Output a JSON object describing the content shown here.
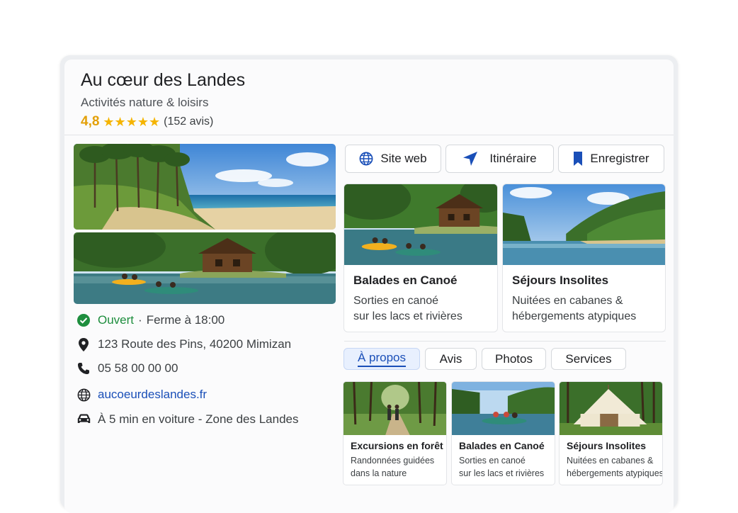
{
  "business": {
    "name": "Au cœur des Landes",
    "category": "Activités nature & loisirs",
    "rating": "4,8",
    "rating_value": 4.8,
    "stars": "★★★★★",
    "reviews": "(152 avis)"
  },
  "info": {
    "status": "Ouvert",
    "separator": "·",
    "hours": "Ferme à 18:00",
    "address": "123 Route des Pins,  40200 Mimizan",
    "phone": "05 58 00 00 00",
    "website": "aucoeurdeslandes.fr",
    "directions": "À 5 min en voiture - Zone des Landes"
  },
  "actions": [
    {
      "label": "Site web",
      "icon": "globe-icon"
    },
    {
      "label": "Itinéraire",
      "icon": "navigation-arrow-icon"
    },
    {
      "label": "Enregistrer",
      "icon": "bookmark-icon"
    }
  ],
  "features": [
    {
      "title": "Balades en Canoé",
      "line1": "Sorties en canoé",
      "line2": "sur les lacs et rivières"
    },
    {
      "title": "Séjours Insolites",
      "line1": "Nuitées en cabanes &",
      "line2": "hébergements atypiques"
    }
  ],
  "tabs": [
    {
      "label": "À propos",
      "active": true
    },
    {
      "label": "Avis",
      "active": false
    },
    {
      "label": "Photos",
      "active": false
    },
    {
      "label": "Services",
      "active": false
    }
  ],
  "activities": [
    {
      "title": "Excursions en forêt",
      "line1": "Randonnées guidées",
      "line2": "dans la nature"
    },
    {
      "title": "Balades en Canoé",
      "line1": "Sorties en canoé",
      "line2": "sur les lacs et rivières"
    },
    {
      "title": "Séjours Insolites",
      "line1": "Nuitées en cabanes &",
      "line2": "hébergements atypiques"
    }
  ],
  "colors": {
    "accent": "#1a4fb8",
    "open_green": "#1e8e3e",
    "rating_gold": "#e3a008",
    "star_yellow": "#f5b400",
    "tab_active_bg": "#e8f0fe"
  }
}
